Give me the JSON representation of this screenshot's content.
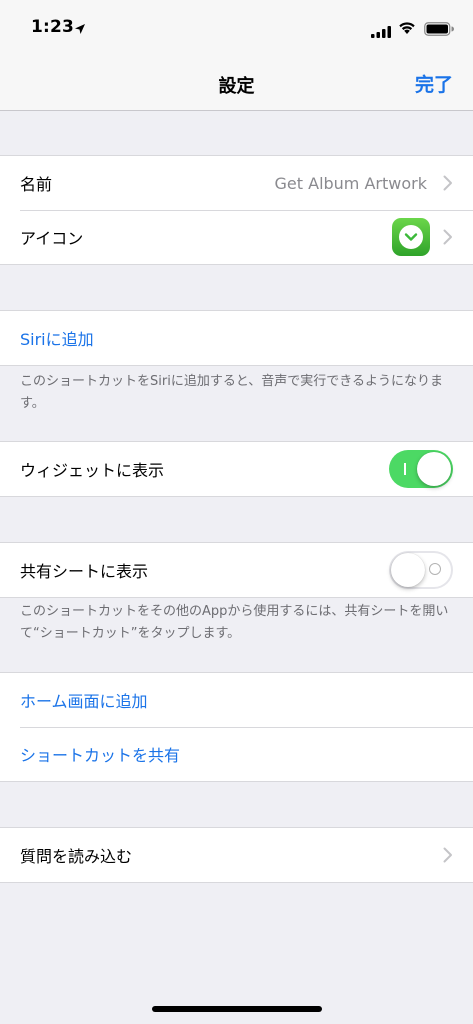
{
  "status_bar": {
    "time": "1:23"
  },
  "nav": {
    "title": "設定",
    "done_label": "完了"
  },
  "section1": {
    "name_label": "名前",
    "name_value": "Get Album Artwork",
    "icon_label": "アイコン"
  },
  "siri": {
    "label": "Siriに追加",
    "footer": "このショートカットをSiriに追加すると、音声で実行できるようになります。"
  },
  "widget": {
    "label": "ウィジェットに表示",
    "enabled": true
  },
  "share_sheet": {
    "label": "共有シートに表示",
    "enabled": false,
    "footer": "このショートカットをその他のAppから使用するには、共有シートを開いて“ショートカット”をタップします。"
  },
  "actions": {
    "home_screen": "ホーム画面に追加",
    "share_shortcut": "ショートカットを共有"
  },
  "import": {
    "label": "質問を読み込む"
  },
  "colors": {
    "accent": "#1a73e8",
    "toggle_on": "#4cd964",
    "icon_green": "#3cb93a"
  }
}
